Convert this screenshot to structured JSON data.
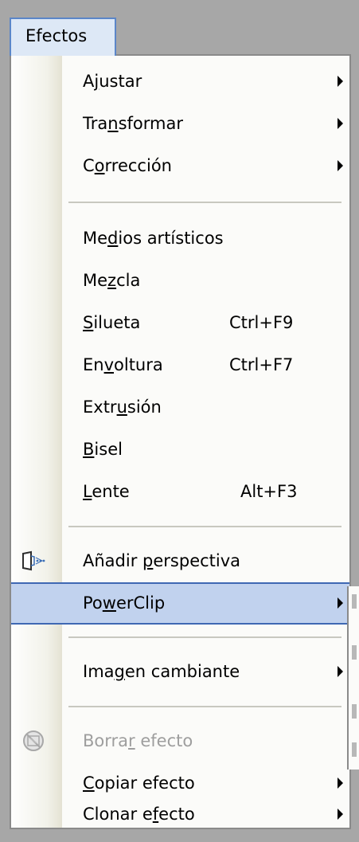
{
  "menu_title": "Efectos",
  "items": [
    {
      "label_pre": "A",
      "label_u": "j",
      "label_post": "ustar",
      "shortcut": "",
      "submenu": true
    },
    {
      "label_pre": "Tra",
      "label_u": "n",
      "label_post": "sformar",
      "shortcut": "",
      "submenu": true
    },
    {
      "label_pre": "C",
      "label_u": "o",
      "label_post": "rrección",
      "shortcut": "",
      "submenu": true
    },
    {
      "label_pre": "Me",
      "label_u": "d",
      "label_post": "ios artísticos",
      "shortcut": "",
      "submenu": false
    },
    {
      "label_pre": "Me",
      "label_u": "z",
      "label_post": "cla",
      "shortcut": "",
      "submenu": false
    },
    {
      "label_pre": "",
      "label_u": "S",
      "label_post": "ilueta",
      "shortcut": "Ctrl+F9",
      "submenu": false
    },
    {
      "label_pre": "En",
      "label_u": "v",
      "label_post": "oltura",
      "shortcut": "Ctrl+F7",
      "submenu": false
    },
    {
      "label_pre": "Extr",
      "label_u": "u",
      "label_post": "sión",
      "shortcut": "",
      "submenu": false
    },
    {
      "label_pre": "",
      "label_u": "B",
      "label_post": "isel",
      "shortcut": "",
      "submenu": false
    },
    {
      "label_pre": "",
      "label_u": "L",
      "label_post": "ente",
      "shortcut": "Alt+F3",
      "submenu": false
    },
    {
      "label_pre": "Añadir ",
      "label_u": "p",
      "label_post": "erspectiva",
      "shortcut": "",
      "submenu": false,
      "icon": "perspective-icon"
    },
    {
      "label_pre": "Po",
      "label_u": "w",
      "label_post": "erClip",
      "shortcut": "",
      "submenu": true,
      "highlighted": true
    },
    {
      "label_pre": "Ima",
      "label_u": "g",
      "label_post": "en cambiante",
      "shortcut": "",
      "submenu": true
    },
    {
      "label_pre": "Borra",
      "label_u": "r",
      "label_post": " efecto",
      "shortcut": "",
      "submenu": false,
      "disabled": true,
      "icon": "clear-effect-icon"
    },
    {
      "label_pre": "",
      "label_u": "C",
      "label_post": "opiar efecto",
      "shortcut": "",
      "submenu": true
    },
    {
      "label_pre": "Clonar e",
      "label_u": "f",
      "label_post": "ecto",
      "shortcut": "",
      "submenu": true
    }
  ],
  "colors": {
    "highlight_bg": "#c1d2ee",
    "highlight_border": "#3f68b3",
    "disabled_text": "#9e9e9e"
  }
}
